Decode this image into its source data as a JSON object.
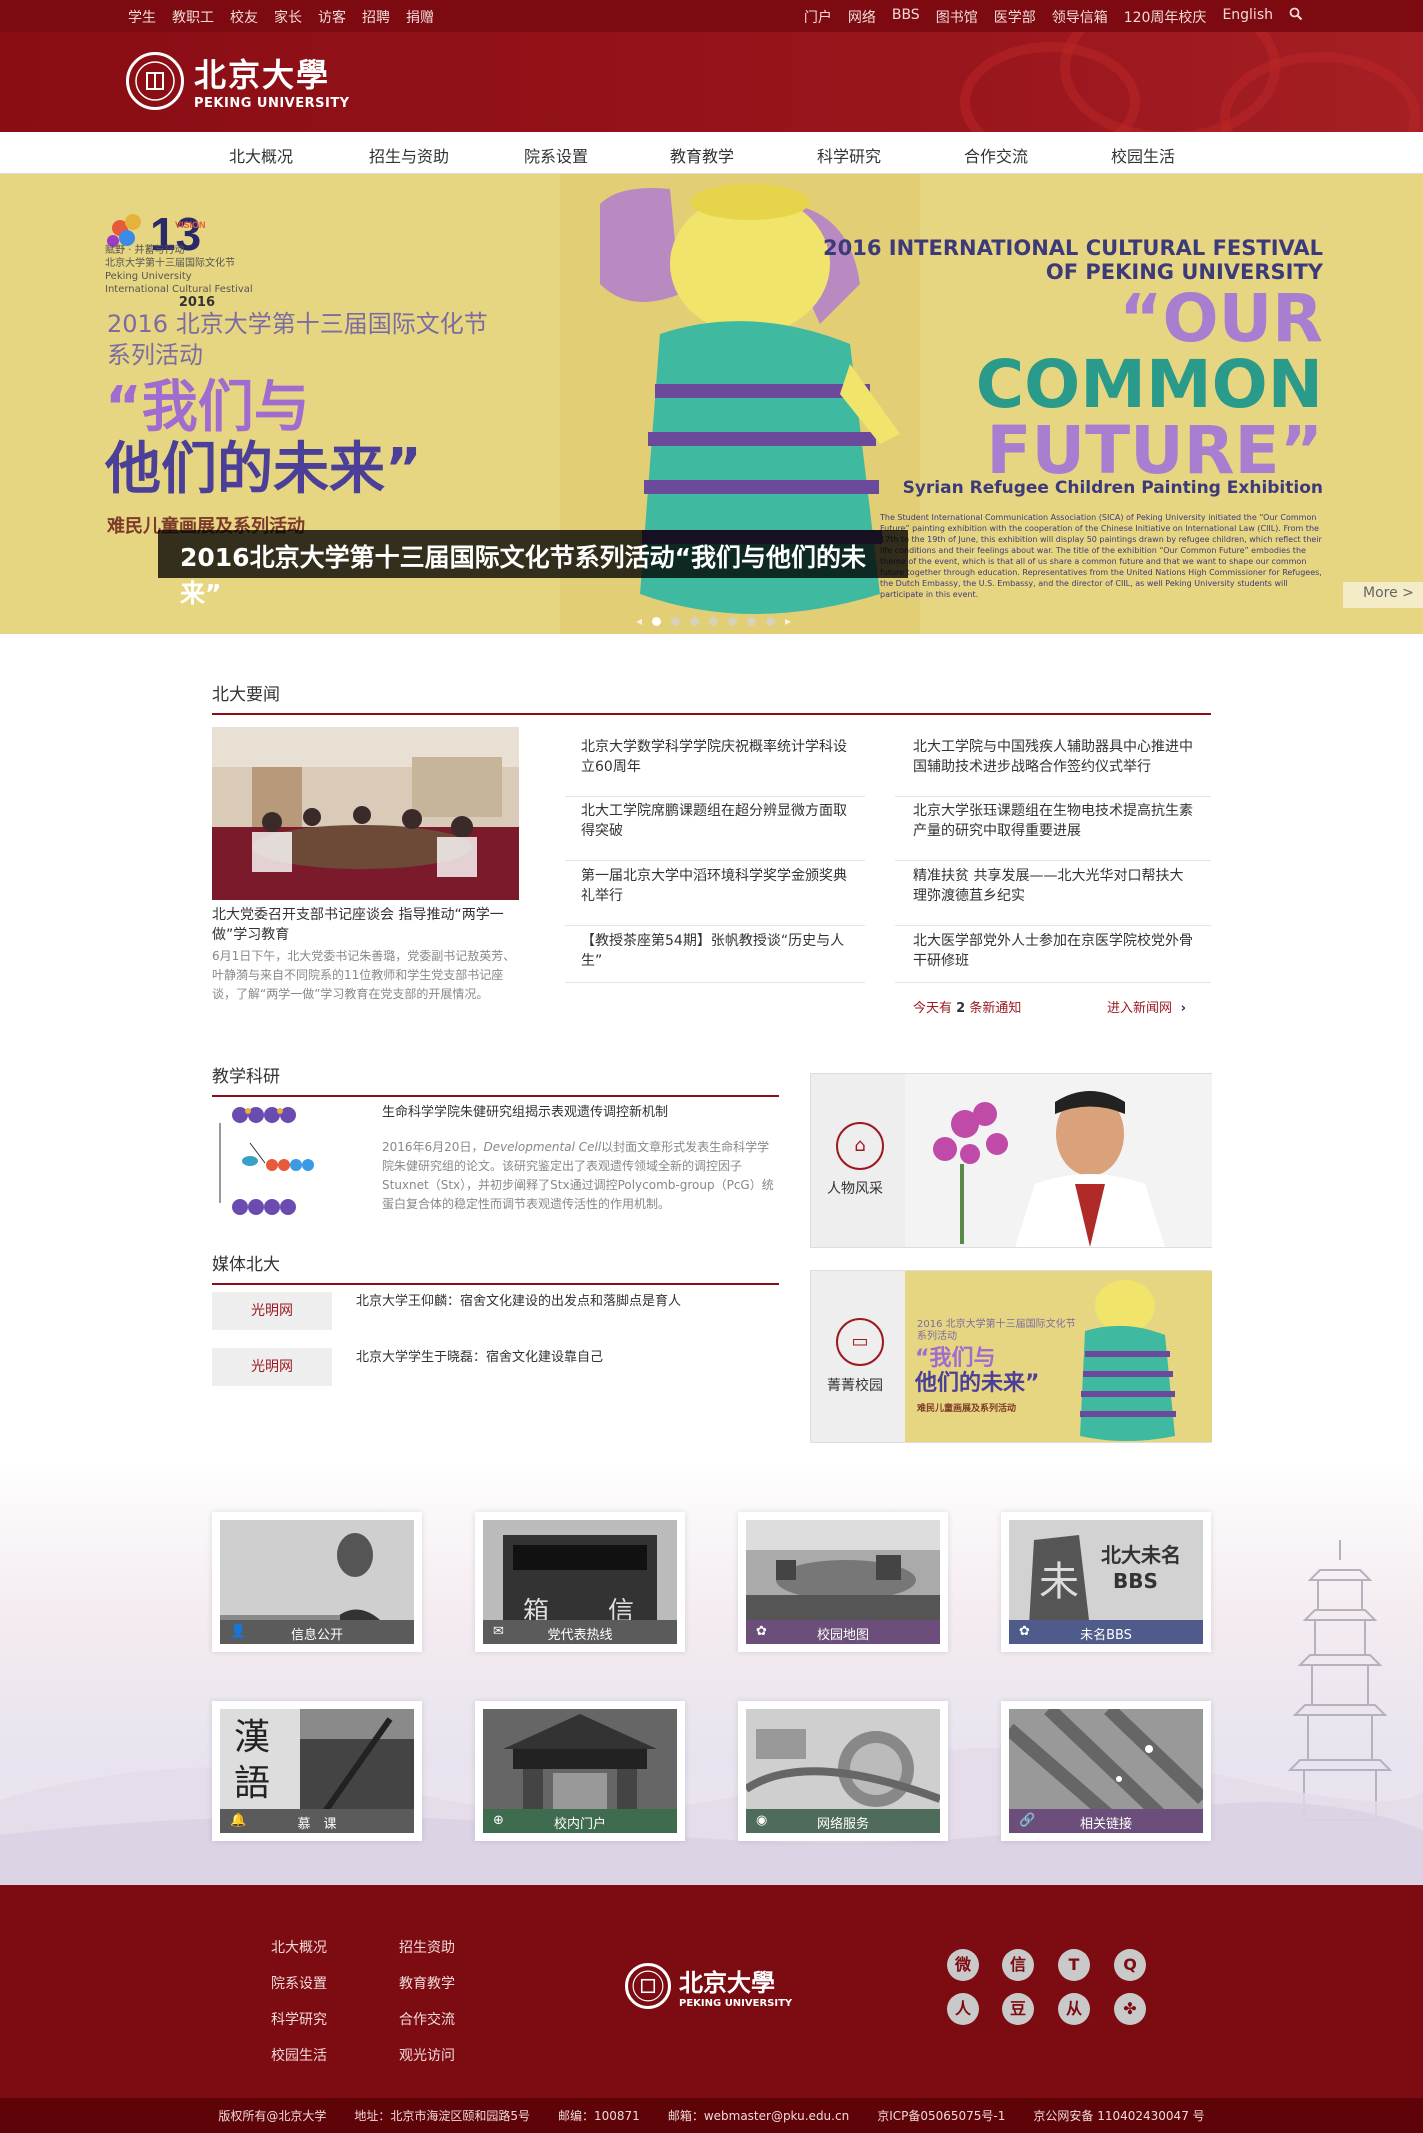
{
  "topbar": {
    "left": [
      "学生",
      "教职工",
      "校友",
      "家长",
      "访客",
      "招聘",
      "捐赠"
    ],
    "right": [
      "门户",
      "网络",
      "BBS",
      "图书馆",
      "医学部",
      "领导信箱",
      "120周年校庆",
      "English"
    ],
    "search_icon": "search-icon"
  },
  "header": {
    "logo_cn": "北京大學",
    "logo_en": "PEKING UNIVERSITY"
  },
  "nav": [
    "北大概况",
    "招生与资助",
    "院系设置",
    "教育教学",
    "科学研究",
    "合作交流",
    "校园生活"
  ],
  "banner": {
    "small_lines": [
      "赋野 · 并蓄与行动",
      "北京大学第十三届国际文化节",
      "Peking University",
      "International Cultural Festival",
      "2016"
    ],
    "subtitle": [
      "2016 北京大学第十三届国际文化节",
      "系列活动"
    ],
    "big_lines": [
      "“我们与",
      "他们的未来”"
    ],
    "small_title": "难民儿童画展及系列活动",
    "fest_lines": [
      "2016 INTERNATIONAL CULTURAL FESTIVAL",
      "OF PEKING UNIVERSITY"
    ],
    "our_lines": [
      "“OUR",
      "COMMON",
      "FUTURE”"
    ],
    "syrian": "Syrian Refugee Children Painting Exhibition",
    "paragraph": "The Student International Communication Association (SICA) of Peking University initiated the “Our Common Future” painting exhibition with the cooperation of the Chinese Initiative on International Law (CIIL). From the 17th to the 19th of June, this exhibition will display 50 paintings drawn by refugee children, which reflect their life conditions and their feelings about war. The title of the exhibition “Our Common Future” embodies the theme of the event, which is that all of us share a common future and that we want to shape our common future together through education. Representatives from the United Nations High Commissioner for Refugees, the Dutch Embassy, the U.S. Embassy, and the director of CIIL, as well Peking University students will participate in this event.",
    "caption": "2016北京大学第十三届国际文化节系列活动“我们与他们的未来”",
    "more": "More >",
    "dots": 7
  },
  "news": {
    "title": "北大要闻",
    "feature_title": "北大党委召开支部书记座谈会 指导推动“两学一做”学习教育",
    "feature_desc": "6月1日下午，北大党委书记朱善璐，党委副书记敖英芳、叶静漪与来自不同院系的11位教师和学生党支部书记座谈，了解“两学一做”学习教育在党支部的开展情况。",
    "col1": [
      "北京大学数学科学学院庆祝概率统计学科设立60周年",
      "北大工学院席鹏课题组在超分辨显微方面取得突破",
      "第一届北京大学中滔环境科学奖学金颁奖典礼举行",
      "【教授茶座第54期】张帆教授谈“历史与人生”"
    ],
    "col2": [
      "北大工学院与中国残疾人辅助器具中心推进中国辅助技术进步战略合作签约仪式举行",
      "北京大学张珏课题组在生物电技术提高抗生素产量的研究中取得重要进展",
      "精准扶贫 共享发展——北大光华对口帮扶大理弥渡德苴乡纪实",
      "北大医学部党外人士参加在京医学院校党外骨干研修班"
    ],
    "today_prefix": "今天有",
    "today_count": "2",
    "today_suffix": "条新通知",
    "enter": "进入新闻网"
  },
  "research": {
    "title": "教学科研",
    "headline": "生命科学学院朱健研究组揭示表观遗传调控新机制",
    "desc_pre": "2016年6月20日，",
    "desc_journal": "Developmental Cell",
    "desc_post": "以封面文章形式发表生命科学学院朱健研究组的论文。该研究鉴定出了表观遗传领域全新的调控因子Stuxnet（Stx），并初步阐释了Stx通过调控Polycomb-group（PcG）统蛋白复合体的稳定性而调节表观遗传活性的作用机制。"
  },
  "media": {
    "title": "媒体北大",
    "items": [
      {
        "source": "光明网",
        "text": "北京大学王仰麟：宿舍文化建设的出发点和落脚点是育人"
      },
      {
        "source": "光明网",
        "text": "北京大学学生于晓磊：宿舍文化建设靠自己"
      }
    ]
  },
  "side": {
    "people": "人物风采",
    "campus": "菁菁校园",
    "mini_banner": {
      "subtitle": [
        "2016 北京大学第十三届国际文化节",
        "系列活动"
      ],
      "big": [
        "“我们与",
        "他们的未来”"
      ],
      "small": "难民儿童画展及系列活动"
    }
  },
  "tiles": [
    {
      "label": "信息公开",
      "icon": "person-icon",
      "color": "#5b5b5b"
    },
    {
      "label": "党代表热线",
      "icon": "mail-icon",
      "color": "#5b5b5b"
    },
    {
      "label": "校园地图",
      "icon": "flower-icon",
      "color": "#6b4f7a"
    },
    {
      "label": "未名BBS",
      "icon": "flower-icon",
      "color": "#4f5b8a",
      "art": [
        "北大未名",
        "BBS"
      ]
    },
    {
      "label": "慕　课",
      "icon": "bell-icon",
      "color": "#5b5b5b",
      "art": [
        "漢",
        "語"
      ]
    },
    {
      "label": "校内门户",
      "icon": "globe-icon",
      "color": "#3f6b4f"
    },
    {
      "label": "网络服务",
      "icon": "wifi-icon",
      "color": "#4f6b5b"
    },
    {
      "label": "相关链接",
      "icon": "link-icon",
      "color": "#6b4f7a"
    }
  ],
  "footer": {
    "links_col1": [
      "北大概况",
      "院系设置",
      "科学研究",
      "校园生活"
    ],
    "links_col2": [
      "招生资助",
      "教育教学",
      "合作交流",
      "观光访问"
    ],
    "logo_cn": "北京大學",
    "logo_en": "PEKING UNIVERSITY",
    "social": [
      {
        "name": "weibo-icon",
        "glyph": "微"
      },
      {
        "name": "wechat-icon",
        "glyph": "信"
      },
      {
        "name": "tencent-icon",
        "glyph": "T"
      },
      {
        "name": "qq-icon",
        "glyph": "Q"
      },
      {
        "name": "renren-icon",
        "glyph": "人"
      },
      {
        "name": "douban-icon",
        "glyph": "豆"
      },
      {
        "name": "community-icon",
        "glyph": "从"
      },
      {
        "name": "clover-icon",
        "glyph": "✤"
      }
    ],
    "bottom": [
      "版权所有@北京大学",
      "地址：北京市海淀区颐和园路5号",
      "邮编：100871",
      "邮箱：webmaster@pku.edu.cn",
      "京ICP备05065075号-1",
      "京公网安备 110402430047 号"
    ]
  }
}
